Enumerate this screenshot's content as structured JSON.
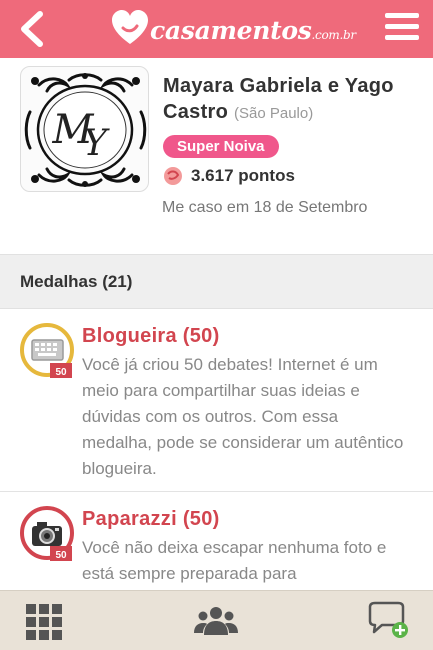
{
  "header": {
    "brand_main": "casamentos",
    "brand_sub": ".com.br",
    "back_icon": "chevron-left-icon",
    "menu_icon": "hamburger-menu-icon"
  },
  "profile": {
    "monogram": "MY",
    "name": "Mayara Gabriela e Yago Castro",
    "city": "(São Paulo)",
    "badge": "Super Noiva",
    "points": "3.617 pontos",
    "wedding_date": "Me caso em 18 de Setembro"
  },
  "medals_section": {
    "title": "Medalhas (21)"
  },
  "medals": [
    {
      "title": "Blogueira (50)",
      "description": "Você já criou 50 debates! Internet é um meio para compartilhar suas ideias e dúvidas com os outros. Com essa medalha, pode se considerar um autêntico blogueira.",
      "icon": "keyboard-medal-icon",
      "count_label": "50",
      "ring_color": "#e6b83c"
    },
    {
      "title": "Paparazzi (50)",
      "description": "Você não deixa escapar nenhuma foto e está sempre preparada para",
      "icon": "camera-medal-icon",
      "count_label": "50",
      "ring_color": "#d2454f"
    }
  ],
  "bottom_nav": {
    "items": [
      "grid-icon",
      "community-icon",
      "new-chat-icon"
    ]
  },
  "colors": {
    "brand": "#ef6a7b",
    "badge": "#f0578b",
    "medal_title": "#d2454f",
    "bottom_bar": "#e9e2d7"
  }
}
